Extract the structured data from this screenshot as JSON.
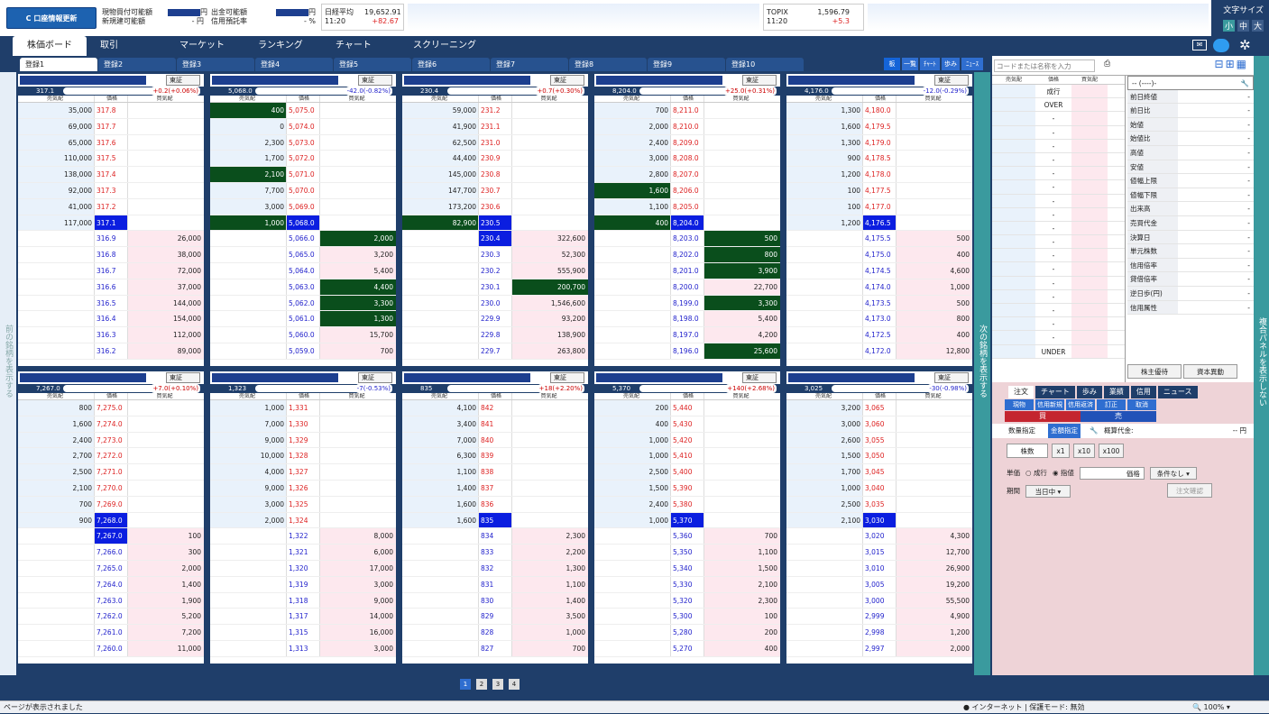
{
  "toolbar": {
    "refresh": "口座情報更新",
    "l1": "現物買付可能額",
    "l2": "新規建可能額",
    "v1": "円",
    "v2": "- 円",
    "l3": "出金可能額",
    "l4": "信用預託率",
    "v3": "円",
    "v4": "- %",
    "n225": "日経平均",
    "n225_time": "11:20",
    "n225_value": "19,652.91",
    "n225_change": "+82.67",
    "topix": "TOPIX",
    "topix_time": "11:20",
    "topix_value": "1,596.79",
    "topix_change": "+5.3",
    "font_size": "文字サイズ",
    "font_small": "小",
    "font_mid": "中",
    "font_big": "大"
  },
  "nav": [
    "株価ボード",
    "取引",
    "マーケット",
    "ランキング",
    "チャート",
    "スクリーニング"
  ],
  "tabs": [
    "登録1",
    "登録2",
    "登録3",
    "登録4",
    "登録5",
    "登録6",
    "登録7",
    "登録8",
    "登録9",
    "登録10"
  ],
  "view_tabs": [
    "板",
    "一覧",
    "ﾁｬｰﾄ",
    "歩み",
    "ﾆｭｰｽ"
  ],
  "left_vert": "前の銘柄を表示する",
  "mid_vert": "次の銘柄を表示する",
  "right_vert": "複合パネルを表示しない",
  "colhead": {
    "sell": "売気配",
    "price": "価格",
    "buy": "買気配"
  },
  "exchange": "東証",
  "panels": [
    {
      "close": "317.1",
      "change": "+0.2(+0.06%)",
      "sell": [
        [
          "35,000",
          "317.8"
        ],
        [
          "69,000",
          "317.7"
        ],
        [
          "65,000",
          "317.6"
        ],
        [
          "110,000",
          "317.5"
        ],
        [
          "138,000",
          "317.4"
        ],
        [
          "92,000",
          "317.3"
        ],
        [
          "41,000",
          "317.2"
        ],
        [
          "117,000",
          "317.1"
        ]
      ],
      "buy": [
        [
          "316.9",
          "26,000"
        ],
        [
          "316.8",
          "38,000"
        ],
        [
          "316.7",
          "72,000"
        ],
        [
          "316.6",
          "37,000"
        ],
        [
          "316.5",
          "144,000"
        ],
        [
          "316.4",
          "154,000"
        ],
        [
          "316.3",
          "112,000"
        ],
        [
          "316.2",
          "89,000"
        ]
      ]
    },
    {
      "close": "5,068.0",
      "change": "-42.0(-0.82%)",
      "sell": [
        [
          "400",
          "5,075.0"
        ],
        [
          "0",
          "5,074.0"
        ],
        [
          "2,300",
          "5,073.0"
        ],
        [
          "1,700",
          "5,072.0"
        ],
        [
          "2,100",
          "5,071.0"
        ],
        [
          "7,700",
          "5,070.0"
        ],
        [
          "3,000",
          "5,069.0"
        ],
        [
          "1,000",
          "5,068.0"
        ]
      ],
      "buy": [
        [
          "5,066.0",
          "2,000"
        ],
        [
          "5,065.0",
          "3,200"
        ],
        [
          "5,064.0",
          "5,400"
        ],
        [
          "5,063.0",
          "4,400"
        ],
        [
          "5,062.0",
          "3,300"
        ],
        [
          "5,061.0",
          "1,300"
        ],
        [
          "5,060.0",
          "15,700"
        ],
        [
          "5,059.0",
          "700"
        ]
      ]
    },
    {
      "close": "230.4",
      "change": "+0.7(+0.30%)",
      "sell": [
        [
          "59,000",
          "231.2"
        ],
        [
          "41,900",
          "231.1"
        ],
        [
          "62,500",
          "231.0"
        ],
        [
          "44,400",
          "230.9"
        ],
        [
          "145,000",
          "230.8"
        ],
        [
          "147,700",
          "230.7"
        ],
        [
          "173,200",
          "230.6"
        ],
        [
          "82,900",
          "230.5"
        ]
      ],
      "buy": [
        [
          "230.4",
          "322,600"
        ],
        [
          "230.3",
          "52,300"
        ],
        [
          "230.2",
          "555,900"
        ],
        [
          "230.1",
          "200,700"
        ],
        [
          "230.0",
          "1,546,600"
        ],
        [
          "229.9",
          "93,200"
        ],
        [
          "229.8",
          "138,900"
        ],
        [
          "229.7",
          "263,800"
        ]
      ]
    },
    {
      "close": "8,204.0",
      "change": "+25.0(+0.31%)",
      "sell": [
        [
          "700",
          "8,211.0"
        ],
        [
          "2,000",
          "8,210.0"
        ],
        [
          "2,400",
          "8,209.0"
        ],
        [
          "3,000",
          "8,208.0"
        ],
        [
          "2,800",
          "8,207.0"
        ],
        [
          "1,600",
          "8,206.0"
        ],
        [
          "1,100",
          "8,205.0"
        ],
        [
          "400",
          "8,204.0"
        ]
      ],
      "buy": [
        [
          "8,203.0",
          "500"
        ],
        [
          "8,202.0",
          "800"
        ],
        [
          "8,201.0",
          "3,900"
        ],
        [
          "8,200.0",
          "22,700"
        ],
        [
          "8,199.0",
          "3,300"
        ],
        [
          "8,198.0",
          "5,400"
        ],
        [
          "8,197.0",
          "4,200"
        ],
        [
          "8,196.0",
          "25,600"
        ]
      ]
    },
    {
      "close": "4,176.0",
      "change": "-12.0(-0.29%)",
      "sell": [
        [
          "1,300",
          "4,180.0"
        ],
        [
          "1,600",
          "4,179.5"
        ],
        [
          "1,300",
          "4,179.0"
        ],
        [
          "900",
          "4,178.5"
        ],
        [
          "1,200",
          "4,178.0"
        ],
        [
          "100",
          "4,177.5"
        ],
        [
          "100",
          "4,177.0"
        ],
        [
          "1,200",
          "4,176.5"
        ]
      ],
      "buy": [
        [
          "4,175.5",
          "500"
        ],
        [
          "4,175.0",
          "400"
        ],
        [
          "4,174.5",
          "4,600"
        ],
        [
          "4,174.0",
          "1,000"
        ],
        [
          "4,173.5",
          "500"
        ],
        [
          "4,173.0",
          "800"
        ],
        [
          "4,172.5",
          "400"
        ],
        [
          "4,172.0",
          "12,800"
        ]
      ]
    },
    {
      "close": "7,267.0",
      "change": "+7.0(+0.10%)",
      "sell": [
        [
          "800",
          "7,275.0"
        ],
        [
          "1,600",
          "7,274.0"
        ],
        [
          "2,400",
          "7,273.0"
        ],
        [
          "2,700",
          "7,272.0"
        ],
        [
          "2,500",
          "7,271.0"
        ],
        [
          "2,100",
          "7,270.0"
        ],
        [
          "700",
          "7,269.0"
        ],
        [
          "900",
          "7,268.0"
        ]
      ],
      "buy": [
        [
          "7,267.0",
          "100"
        ],
        [
          "7,266.0",
          "300"
        ],
        [
          "7,265.0",
          "2,000"
        ],
        [
          "7,264.0",
          "1,400"
        ],
        [
          "7,263.0",
          "1,900"
        ],
        [
          "7,262.0",
          "5,200"
        ],
        [
          "7,261.0",
          "7,200"
        ],
        [
          "7,260.0",
          "11,000"
        ]
      ]
    },
    {
      "close": "1,323",
      "change": "-7(-0.53%)",
      "sell": [
        [
          "1,000",
          "1,331"
        ],
        [
          "7,000",
          "1,330"
        ],
        [
          "9,000",
          "1,329"
        ],
        [
          "10,000",
          "1,328"
        ],
        [
          "4,000",
          "1,327"
        ],
        [
          "9,000",
          "1,326"
        ],
        [
          "3,000",
          "1,325"
        ],
        [
          "2,000",
          "1,324"
        ]
      ],
      "buy": [
        [
          "1,322",
          "8,000"
        ],
        [
          "1,321",
          "6,000"
        ],
        [
          "1,320",
          "17,000"
        ],
        [
          "1,319",
          "3,000"
        ],
        [
          "1,318",
          "9,000"
        ],
        [
          "1,317",
          "14,000"
        ],
        [
          "1,315",
          "16,000"
        ],
        [
          "1,313",
          "3,000"
        ]
      ]
    },
    {
      "close": "835",
      "change": "+18(+2.20%)",
      "sell": [
        [
          "4,100",
          "842"
        ],
        [
          "3,400",
          "841"
        ],
        [
          "7,000",
          "840"
        ],
        [
          "6,300",
          "839"
        ],
        [
          "1,100",
          "838"
        ],
        [
          "1,400",
          "837"
        ],
        [
          "1,600",
          "836"
        ],
        [
          "1,600",
          "835"
        ]
      ],
      "buy": [
        [
          "834",
          "2,300"
        ],
        [
          "833",
          "2,200"
        ],
        [
          "832",
          "1,300"
        ],
        [
          "831",
          "1,100"
        ],
        [
          "830",
          "1,400"
        ],
        [
          "829",
          "3,500"
        ],
        [
          "828",
          "1,000"
        ],
        [
          "827",
          "700"
        ]
      ]
    },
    {
      "close": "5,370",
      "change": "+140(+2.68%)",
      "sell": [
        [
          "200",
          "5,440"
        ],
        [
          "400",
          "5,430"
        ],
        [
          "1,000",
          "5,420"
        ],
        [
          "1,000",
          "5,410"
        ],
        [
          "2,500",
          "5,400"
        ],
        [
          "1,500",
          "5,390"
        ],
        [
          "2,400",
          "5,380"
        ],
        [
          "1,000",
          "5,370"
        ]
      ],
      "buy": [
        [
          "5,360",
          "700"
        ],
        [
          "5,350",
          "1,100"
        ],
        [
          "5,340",
          "1,500"
        ],
        [
          "5,330",
          "2,100"
        ],
        [
          "5,320",
          "2,300"
        ],
        [
          "5,300",
          "100"
        ],
        [
          "5,280",
          "200"
        ],
        [
          "5,270",
          "400"
        ]
      ]
    },
    {
      "close": "3,025",
      "change": "-30(-0.98%)",
      "sell": [
        [
          "3,200",
          "3,065"
        ],
        [
          "3,000",
          "3,060"
        ],
        [
          "2,600",
          "3,055"
        ],
        [
          "1,500",
          "3,050"
        ],
        [
          "1,700",
          "3,045"
        ],
        [
          "1,000",
          "3,040"
        ],
        [
          "2,500",
          "3,035"
        ],
        [
          "2,100",
          "3,030"
        ]
      ],
      "buy": [
        [
          "3,020",
          "4,300"
        ],
        [
          "3,015",
          "12,700"
        ],
        [
          "3,010",
          "26,900"
        ],
        [
          "3,005",
          "19,200"
        ],
        [
          "3,000",
          "55,500"
        ],
        [
          "2,999",
          "4,900"
        ],
        [
          "2,998",
          "1,200"
        ],
        [
          "2,997",
          "2,000"
        ]
      ]
    }
  ],
  "right": {
    "search_ph": "コードまたは名称を入力",
    "info_head": "-- (----)-",
    "info": [
      "前日終値",
      "前日比",
      "始値",
      "始値比",
      "高値",
      "安値",
      "値幅上限",
      "値幅下限",
      "出来高",
      "売買代金",
      "決算日",
      "単元株数",
      "信用倍率",
      "貸借倍率",
      "逆日歩(円)",
      "信用属性"
    ],
    "board_top": [
      "成行",
      "OVER"
    ],
    "board_bottom": "UNDER",
    "yutai": "株主優待",
    "shihon": "資本異動",
    "otabs": [
      "注文",
      "チャート",
      "歩み",
      "業績",
      "信用",
      "ニュース"
    ],
    "subtabs": [
      "現物",
      "信用新規",
      "信用返済",
      "訂正",
      "取消"
    ],
    "buy": "買",
    "sell": "売",
    "qty_spec": "数量指定",
    "amt_spec": "金額指定",
    "gaisan": "概算代金:",
    "yen": "-- 円",
    "qty_ph": "株数",
    "x1": "x1",
    "x10": "x10",
    "x100": "x100",
    "tanka": "単価",
    "nari": "成行",
    "sashi": "指値",
    "price_ph": "価格",
    "cond": "条件なし",
    "kikan": "期間",
    "today": "当日中",
    "confirm": "注文確認"
  },
  "pager": [
    "1",
    "2",
    "3",
    "4"
  ],
  "status": {
    "left": "ページが表示されました",
    "zone": "インターネット | 保護モード: 無効",
    "zoom": "100%"
  }
}
